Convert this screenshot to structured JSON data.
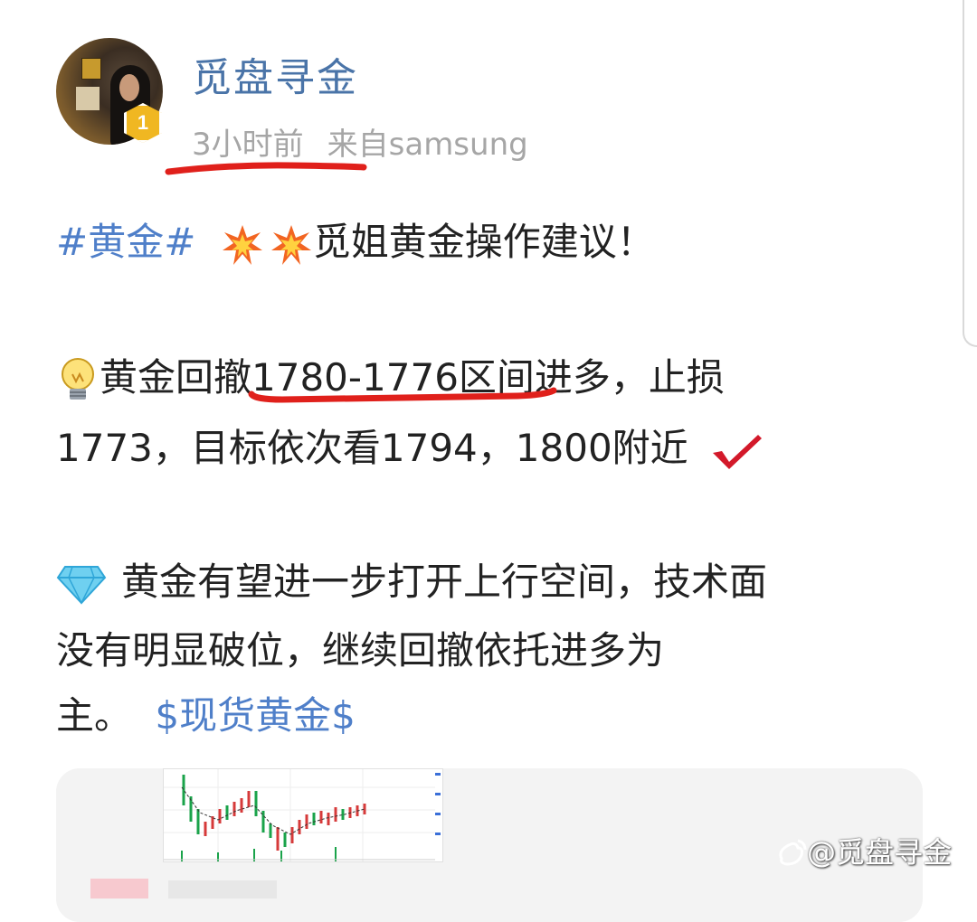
{
  "post": {
    "username": "觅盘寻金",
    "avatar_badge": "1",
    "time": "3小时前",
    "source": "来自samsung"
  },
  "content": {
    "topic_tag": "#黄金#",
    "headline": "觅姐黄金操作建议！",
    "para1_line1": "黄金回撤1780-1776区间进多，止损",
    "para1_line2": "1773，目标依次看1794，1800附近",
    "para2_line1": "黄金有望进一步打开上行空间，技术面",
    "para2_line2": "没有明显破位，继续回撤依托进多为",
    "para2_line3": "主。",
    "stock_link": "$现货黄金$"
  },
  "icons": [
    "collision-icon",
    "lightbulb-icon",
    "check-mark-icon",
    "gem-icon",
    "weibo-logo-icon"
  ],
  "watermark": "@觅盘寻金",
  "colors": {
    "username": "#4a74a8",
    "link": "#4f7fc9",
    "annotation": "#e0201b",
    "meta": "#a6a6a6"
  }
}
